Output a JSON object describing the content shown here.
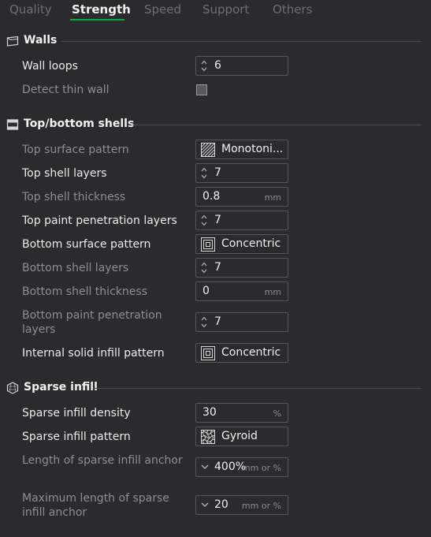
{
  "tabs": [
    "Quality",
    "Strength",
    "Speed",
    "Support",
    "Others"
  ],
  "active_tab": "Strength",
  "accent_color": "#00ae42",
  "sections": {
    "walls": {
      "title": "Walls",
      "icon": "walls-icon"
    },
    "shells": {
      "title": "Top/bottom shells",
      "icon": "shells-icon"
    },
    "infill": {
      "title": "Sparse infill",
      "icon": "hexagon-icon"
    }
  },
  "walls": {
    "wall_loops": {
      "label": "Wall loops",
      "value": "6"
    },
    "detect_thin_wall": {
      "label": "Detect thin wall",
      "checked": false
    }
  },
  "shells": {
    "top_surface_pattern": {
      "label": "Top surface pattern",
      "value": "Monotoni..."
    },
    "top_shell_layers": {
      "label": "Top shell layers",
      "value": "7"
    },
    "top_shell_thickness": {
      "label": "Top shell thickness",
      "value": "0.8",
      "unit": "mm"
    },
    "top_paint_penetration": {
      "label": "Top paint penetration layers",
      "value": "7"
    },
    "bottom_surface_pattern": {
      "label": "Bottom surface pattern",
      "value": "Concentric"
    },
    "bottom_shell_layers": {
      "label": "Bottom shell layers",
      "value": "7"
    },
    "bottom_shell_thickness": {
      "label": "Bottom shell thickness",
      "value": "0",
      "unit": "mm"
    },
    "bottom_paint_penetration": {
      "label": "Bottom paint penetration layers",
      "value": "7"
    },
    "internal_solid_infill": {
      "label": "Internal solid infill pattern",
      "value": "Concentric"
    }
  },
  "infill": {
    "density": {
      "label": "Sparse infill density",
      "value": "30",
      "unit": "%"
    },
    "pattern": {
      "label": "Sparse infill pattern",
      "value": "Gyroid"
    },
    "anchor_length": {
      "label": "Length of sparse infill anchor",
      "value": "400%",
      "unit": "mm or %"
    },
    "anchor_max": {
      "label": "Maximum length of sparse infill anchor",
      "value": "20",
      "unit": "mm or %"
    }
  }
}
